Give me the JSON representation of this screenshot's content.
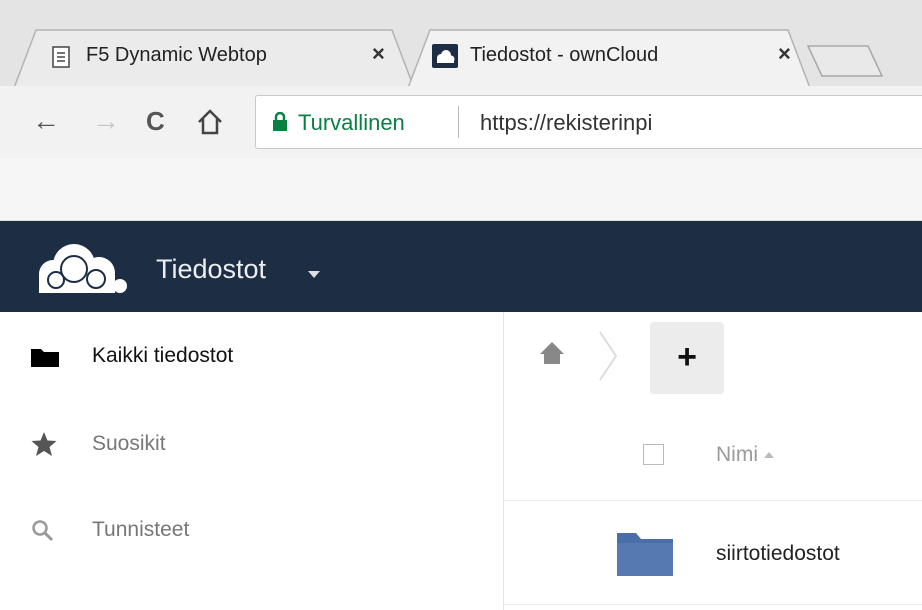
{
  "browser": {
    "tabs": [
      {
        "title": "F5 Dynamic Webtop",
        "close": "×",
        "icon": "page-icon",
        "active": false
      },
      {
        "title": "Tiedostot - ownCloud",
        "close": "×",
        "icon": "owncloud-favicon",
        "active": true
      }
    ],
    "nav": {
      "back": "←",
      "forward": "→",
      "reload": "C",
      "home": "⌂"
    },
    "address": {
      "secure_label": "Turvallinen",
      "url": "https://rekisterinpi",
      "lock_icon": "lock-icon",
      "secure_color": "#0b8043"
    }
  },
  "header": {
    "logo_icon": "owncloud-logo-icon",
    "app_name": "Tiedostot",
    "background": "#1d2d44"
  },
  "sidebar": {
    "items": [
      {
        "label": "Kaikki tiedostot",
        "icon": "folder-icon",
        "active": true
      },
      {
        "label": "Suosikit",
        "icon": "star-icon",
        "active": false
      },
      {
        "label": "Tunnisteet",
        "icon": "search-icon",
        "active": false
      }
    ]
  },
  "files": {
    "breadcrumb_icon": "home-icon",
    "new_button": "+",
    "columns": {
      "name": "Nimi"
    },
    "rows": [
      {
        "name": "siirtotiedostot",
        "type": "folder",
        "icon_color": "#4a6ea8"
      }
    ]
  }
}
